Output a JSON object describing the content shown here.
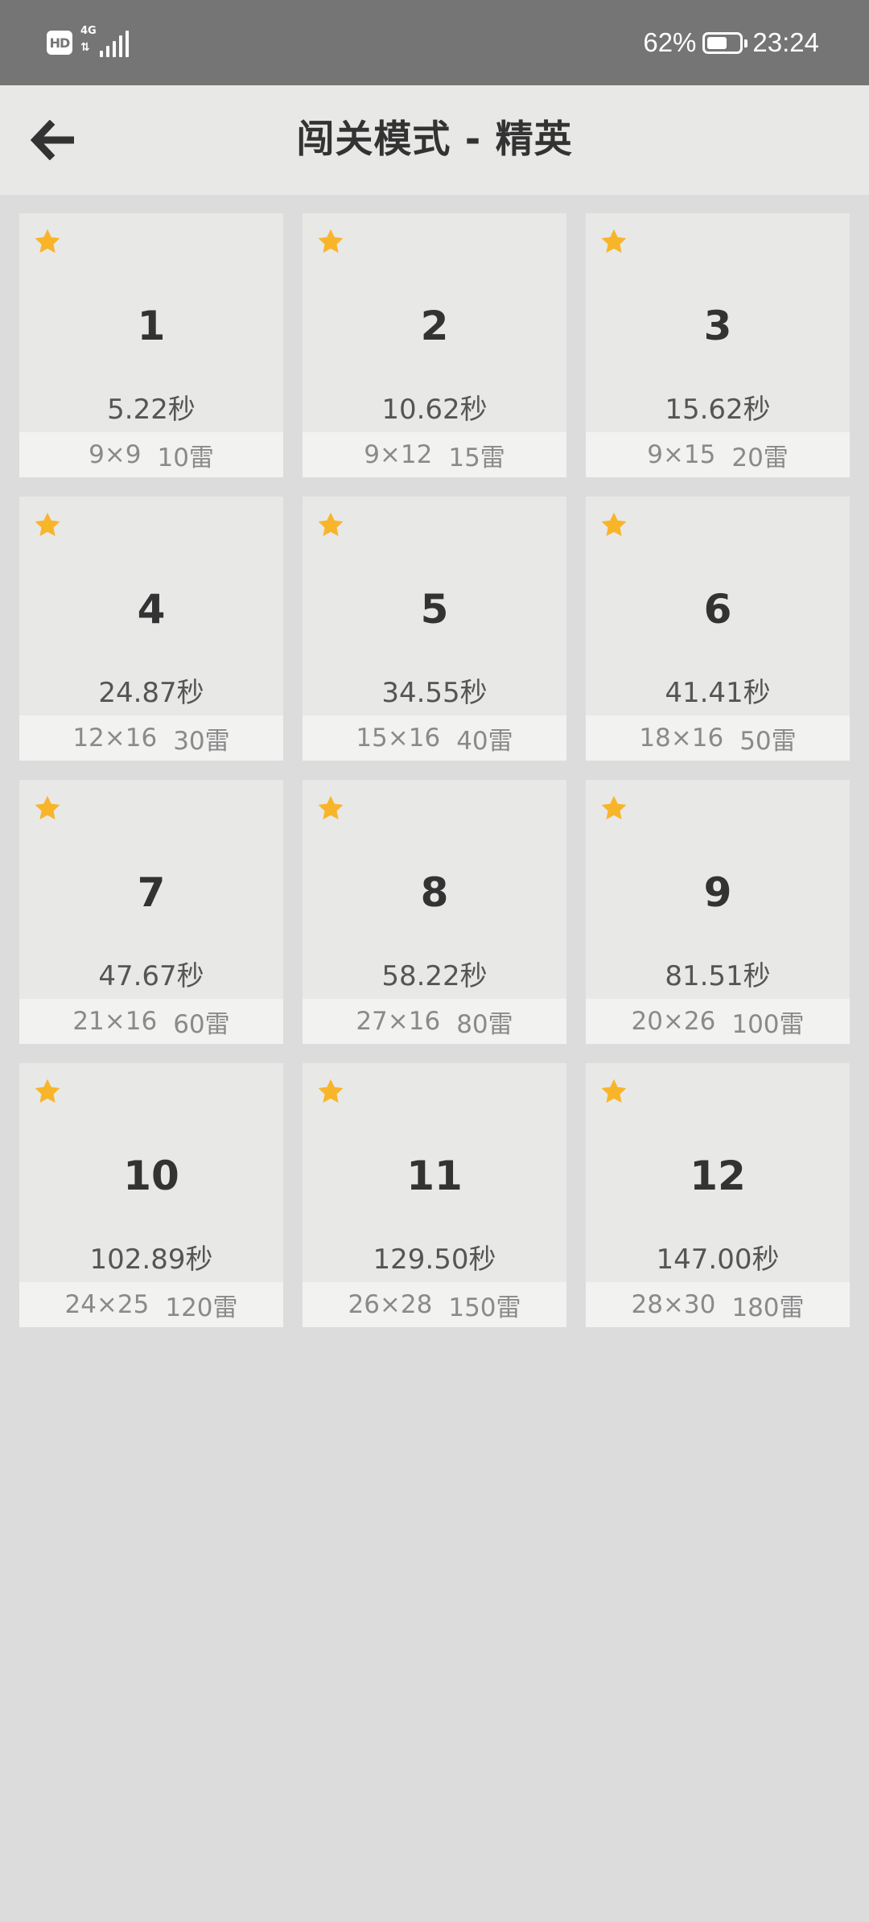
{
  "status_bar": {
    "hd_label": "HD",
    "network_label": "4G",
    "battery_text": "62%",
    "battery_level": 0.62,
    "time": "23:24"
  },
  "header": {
    "back_icon": "arrow-left-icon",
    "title": "闯关模式 - 精英"
  },
  "colors": {
    "star": "#f8b52a",
    "card_bg": "#e8e8e7",
    "page_bg": "#dcdcdc"
  },
  "levels": [
    {
      "number": "1",
      "time": "5.22秒",
      "size": "9×9",
      "mines": "10雷",
      "star_icon": "star-icon"
    },
    {
      "number": "2",
      "time": "10.62秒",
      "size": "9×12",
      "mines": "15雷",
      "star_icon": "star-icon"
    },
    {
      "number": "3",
      "time": "15.62秒",
      "size": "9×15",
      "mines": "20雷",
      "star_icon": "star-icon"
    },
    {
      "number": "4",
      "time": "24.87秒",
      "size": "12×16",
      "mines": "30雷",
      "star_icon": "star-icon"
    },
    {
      "number": "5",
      "time": "34.55秒",
      "size": "15×16",
      "mines": "40雷",
      "star_icon": "star-icon"
    },
    {
      "number": "6",
      "time": "41.41秒",
      "size": "18×16",
      "mines": "50雷",
      "star_icon": "star-icon"
    },
    {
      "number": "7",
      "time": "47.67秒",
      "size": "21×16",
      "mines": "60雷",
      "star_icon": "star-icon"
    },
    {
      "number": "8",
      "time": "58.22秒",
      "size": "27×16",
      "mines": "80雷",
      "star_icon": "star-icon"
    },
    {
      "number": "9",
      "time": "81.51秒",
      "size": "20×26",
      "mines": "100雷",
      "star_icon": "star-icon"
    },
    {
      "number": "10",
      "time": "102.89秒",
      "size": "24×25",
      "mines": "120雷",
      "star_icon": "star-icon"
    },
    {
      "number": "11",
      "time": "129.50秒",
      "size": "26×28",
      "mines": "150雷",
      "star_icon": "star-icon"
    },
    {
      "number": "12",
      "time": "147.00秒",
      "size": "28×30",
      "mines": "180雷",
      "star_icon": "star-icon"
    }
  ]
}
